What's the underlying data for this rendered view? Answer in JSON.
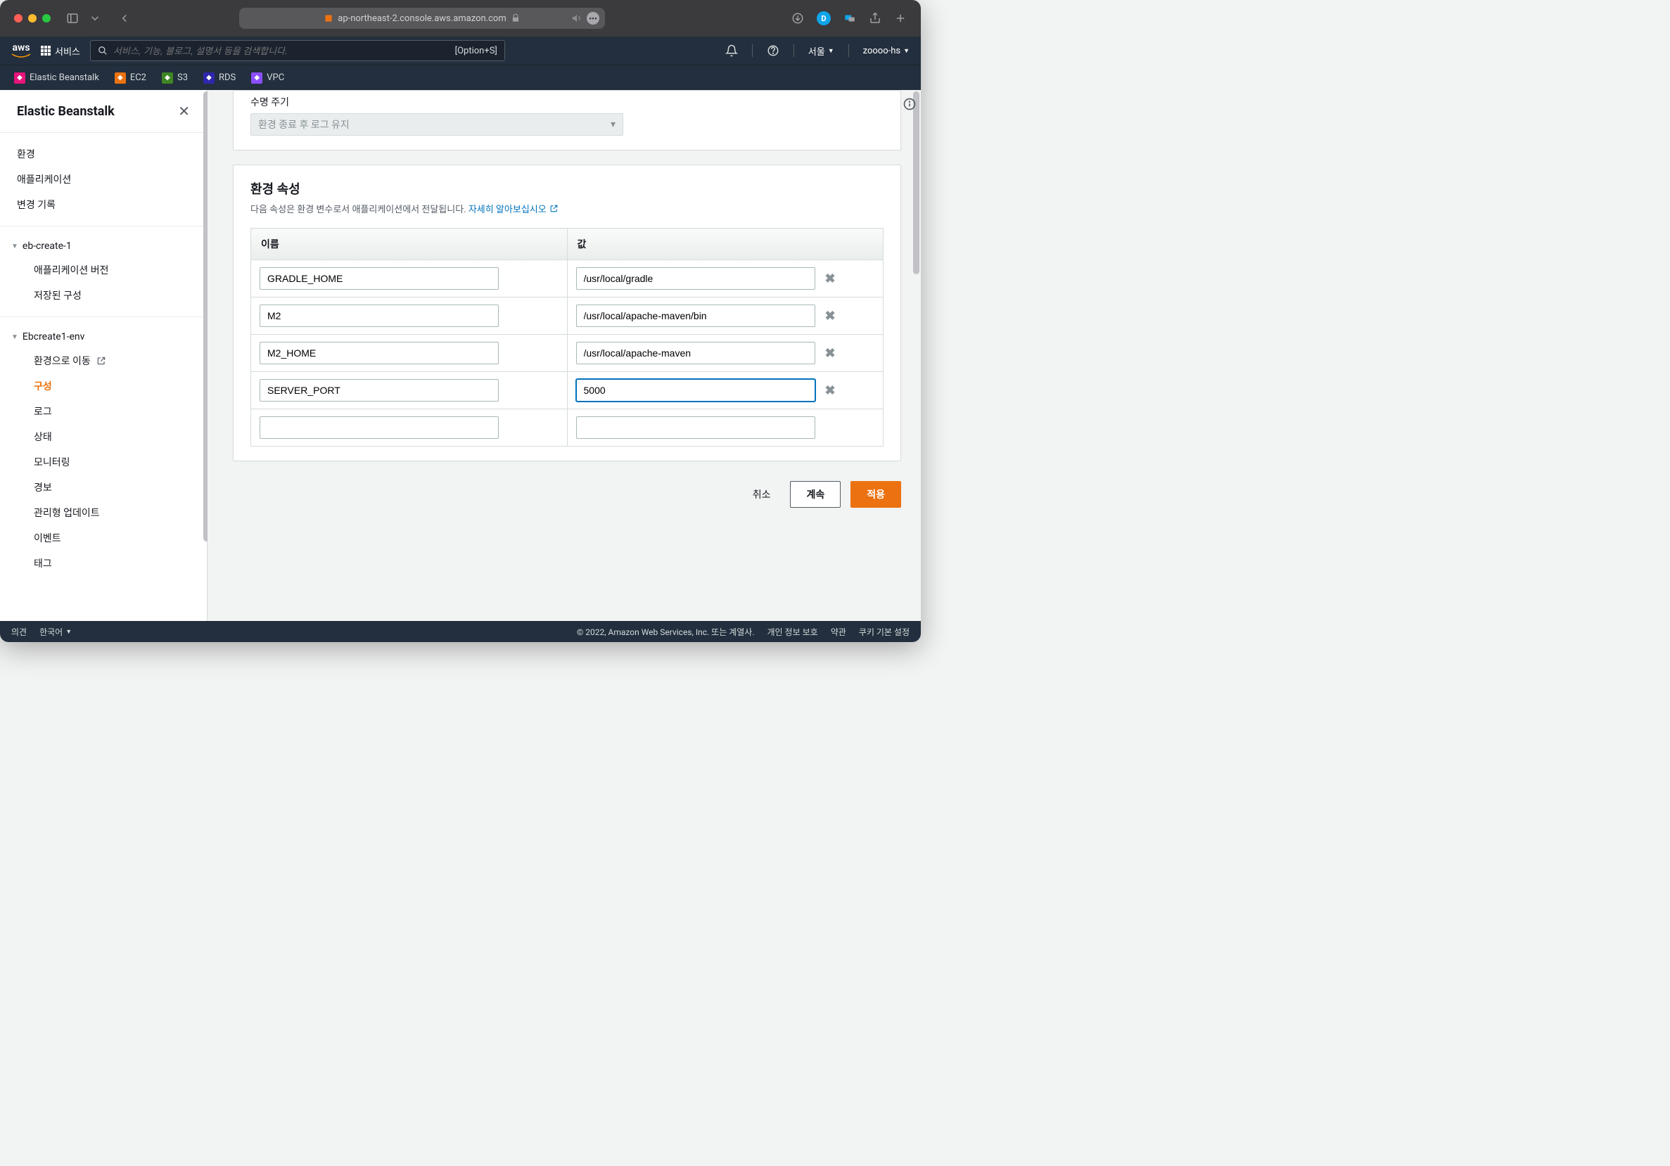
{
  "browser": {
    "url_host": "ap-northeast-2.console.aws.amazon.com",
    "blue_badge": "D"
  },
  "aws_nav": {
    "services_label": "서비스",
    "search_placeholder": "서비스, 기능, 블로그, 설명서 등을 검색합니다.",
    "search_shortcut": "[Option+S]",
    "region": "서울",
    "user": "zoooo-hs"
  },
  "favorites": [
    {
      "label": "Elastic Beanstalk",
      "cls": "fav-eb"
    },
    {
      "label": "EC2",
      "cls": "fav-ec2"
    },
    {
      "label": "S3",
      "cls": "fav-s3"
    },
    {
      "label": "RDS",
      "cls": "fav-rds"
    },
    {
      "label": "VPC",
      "cls": "fav-vpc"
    }
  ],
  "sidebar": {
    "title": "Elastic Beanstalk",
    "top_links": [
      "환경",
      "애플리케이션",
      "변경 기록"
    ],
    "app": {
      "name": "eb-create-1",
      "children": [
        "애플리케이션 버전",
        "저장된 구성"
      ]
    },
    "env": {
      "name": "Ebcreate1-env",
      "go_to_env": "환경으로 이동",
      "children": [
        "구성",
        "로그",
        "상태",
        "모니터링",
        "경보",
        "관리형 업데이트",
        "이벤트",
        "태그"
      ]
    }
  },
  "lifecycle": {
    "label": "수명 주기",
    "select_text": "환경 종료 후 로그 유지"
  },
  "env_props": {
    "title": "환경 속성",
    "desc": "다음 속성은 환경 변수로서 애플리케이션에서 전달됩니다.",
    "learn_more": "자세히 알아보십시오",
    "col_name": "이름",
    "col_value": "값",
    "rows": [
      {
        "name": "GRADLE_HOME",
        "value": "/usr/local/gradle"
      },
      {
        "name": "M2",
        "value": "/usr/local/apache-maven/bin"
      },
      {
        "name": "M2_HOME",
        "value": "/usr/local/apache-maven"
      },
      {
        "name": "SERVER_PORT",
        "value": "5000",
        "focused": true
      },
      {
        "name": "",
        "value": "",
        "empty": true
      }
    ]
  },
  "actions": {
    "cancel": "취소",
    "continue": "계속",
    "apply": "적용"
  },
  "footer": {
    "feedback": "의견",
    "language": "한국어",
    "copyright": "© 2022, Amazon Web Services, Inc. 또는 계열사.",
    "privacy": "개인 정보 보호",
    "terms": "약관",
    "cookies": "쿠키 기본 설정"
  }
}
